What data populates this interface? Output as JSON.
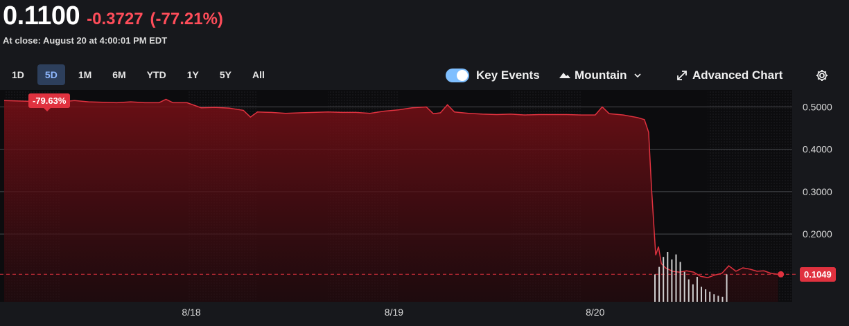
{
  "quote": {
    "price": "0.1100",
    "change": "-0.3727",
    "change_pct": "(-77.21%)",
    "close_info": "At close: August 20 at 4:00:01 PM EDT"
  },
  "ranges": [
    "1D",
    "5D",
    "1M",
    "6M",
    "YTD",
    "1Y",
    "5Y",
    "All"
  ],
  "active_range": "5D",
  "toolbar": {
    "key_events_label": "Key Events",
    "key_events_on": true,
    "chart_type_label": "Mountain",
    "advanced_chart_label": "Advanced Chart"
  },
  "colors": {
    "background": "#17181c",
    "line": "#e0323f",
    "down": "#ff4d5a",
    "active_range_bg": "#2d3f5c",
    "toggle": "#7fbfff"
  },
  "chart_data": {
    "type": "area",
    "period_change_label": "-79.63%",
    "last_price_label": "0.1049",
    "y_ticks": [
      "0.5000",
      "0.4000",
      "0.3000",
      "0.2000"
    ],
    "ylim": [
      0.04,
      0.54
    ],
    "x_ticks": [
      "8/18",
      "8/19",
      "8/20"
    ],
    "previous_close": 0.1049,
    "series": [
      {
        "values": [
          [
            0,
            0.515
          ],
          [
            1,
            0.514
          ],
          [
            2,
            0.513
          ],
          [
            3,
            0.512
          ],
          [
            4,
            0.512
          ],
          [
            5,
            0.515
          ],
          [
            6,
            0.512
          ],
          [
            7,
            0.511
          ],
          [
            8,
            0.51
          ],
          [
            9,
            0.512
          ],
          [
            10,
            0.51
          ],
          [
            11,
            0.51
          ],
          [
            11.5,
            0.518
          ],
          [
            12,
            0.51
          ],
          [
            13,
            0.51
          ],
          [
            14,
            0.498
          ],
          [
            15,
            0.499
          ],
          [
            16,
            0.497
          ],
          [
            17,
            0.492
          ],
          [
            17.5,
            0.476
          ],
          [
            18,
            0.488
          ],
          [
            19,
            0.487
          ],
          [
            20,
            0.485
          ],
          [
            21,
            0.486
          ],
          [
            22,
            0.487
          ],
          [
            23,
            0.488
          ],
          [
            24,
            0.487
          ],
          [
            25,
            0.487
          ],
          [
            26,
            0.485
          ],
          [
            27,
            0.49
          ],
          [
            28,
            0.493
          ],
          [
            29,
            0.498
          ],
          [
            30,
            0.5
          ],
          [
            30.5,
            0.484
          ],
          [
            31,
            0.486
          ],
          [
            31.5,
            0.505
          ],
          [
            32,
            0.488
          ],
          [
            33,
            0.485
          ],
          [
            34,
            0.483
          ],
          [
            35,
            0.482
          ],
          [
            36,
            0.483
          ],
          [
            37,
            0.481
          ],
          [
            38,
            0.482
          ],
          [
            39,
            0.482
          ],
          [
            40,
            0.482
          ],
          [
            41,
            0.481
          ],
          [
            42,
            0.481
          ],
          [
            42.5,
            0.5
          ],
          [
            43,
            0.484
          ],
          [
            44,
            0.481
          ],
          [
            45,
            0.475
          ],
          [
            45.5,
            0.47
          ],
          [
            45.8,
            0.44
          ],
          [
            46,
            0.31
          ],
          [
            46.3,
            0.15
          ],
          [
            46.5,
            0.17
          ],
          [
            46.7,
            0.13
          ],
          [
            47,
            0.12
          ],
          [
            47.5,
            0.112
          ],
          [
            48,
            0.11
          ],
          [
            48.5,
            0.113
          ],
          [
            49,
            0.11
          ],
          [
            49.5,
            0.1
          ],
          [
            50,
            0.097
          ],
          [
            50.5,
            0.103
          ],
          [
            51,
            0.107
          ],
          [
            51.5,
            0.125
          ],
          [
            52,
            0.112
          ],
          [
            52.5,
            0.12
          ],
          [
            53,
            0.117
          ],
          [
            53.5,
            0.112
          ],
          [
            54,
            0.113
          ],
          [
            54.5,
            0.107
          ],
          [
            55,
            0.105
          ]
        ]
      }
    ],
    "grid": true,
    "y_axis_position": "right"
  }
}
